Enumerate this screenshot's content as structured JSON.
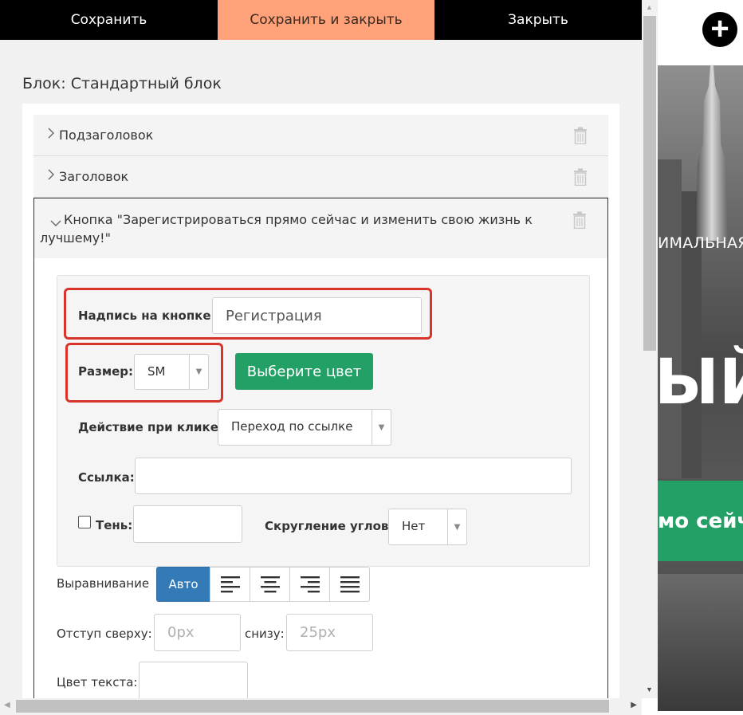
{
  "toolbar": {
    "save_label": "Сохранить",
    "save_close_label": "Сохранить и закрыть",
    "close_label": "Закрыть"
  },
  "block_title": "Блок: Стандартный блок",
  "accordion": {
    "subtitle_label": "Подзаголовок",
    "heading_label": "Заголовок",
    "button_label": "Кнопка \"Зарегистрироваться прямо сейчас и изменить свою жизнь к лучшему!\""
  },
  "form": {
    "caption_label": "Надпись на кнопке:",
    "caption_value": "Регистрация",
    "size_label": "Размер:",
    "size_value": "SM",
    "color_button": "Выберите цвет",
    "action_label": "Действие при клике:",
    "action_value": "Переход по ссылке",
    "link_label": "Ссылка:",
    "link_value": "",
    "shadow_label": "Тень:",
    "shadow_value": "",
    "radius_label": "Скругление углов:",
    "radius_value": "Нет"
  },
  "alignment": {
    "label": "Выравнивание",
    "auto_label": "Авто",
    "options": [
      "align-left-icon",
      "align-center-icon",
      "align-right-icon",
      "align-justify-icon"
    ]
  },
  "padding": {
    "top_label": "Отступ сверху:",
    "top_placeholder": "0px",
    "bottom_label": "снизу:",
    "bottom_placeholder": "25px"
  },
  "text_color_label": "Цвет текста:",
  "preview": {
    "small_text": "ИМАЛЬНАЯ",
    "big_text": "ЫЙ",
    "button_text": "мо сейча"
  },
  "colors": {
    "save_close_bg": "#ffa27a",
    "green_accent": "#23a066",
    "blue_accent": "#337ab7",
    "highlight_red": "#d9342b"
  }
}
